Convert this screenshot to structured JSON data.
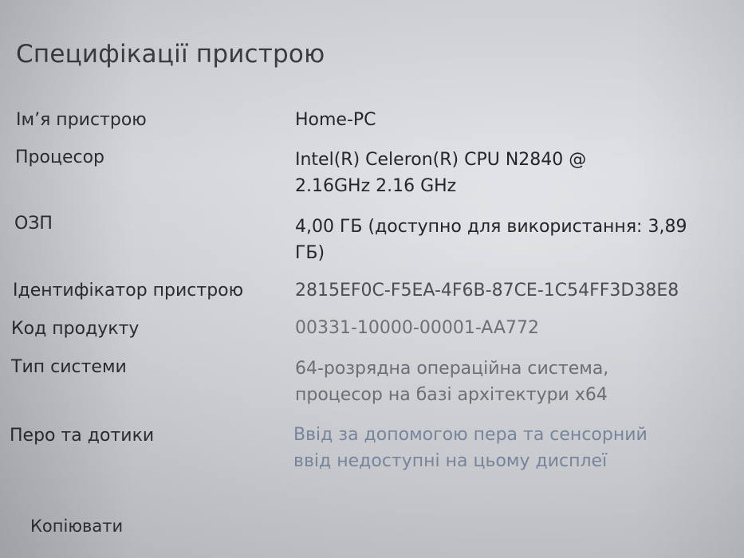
{
  "page": {
    "title": "Специфікації пристрою"
  },
  "specs": [
    {
      "label": "Ім’я пристрою",
      "value_lines": [
        "Home-PC"
      ]
    },
    {
      "label": "Процесор",
      "value_lines": [
        "Intel(R) Celeron(R) CPU  N2840  @",
        "2.16GHz   2.16 GHz"
      ]
    },
    {
      "label": "ОЗП",
      "value_lines": [
        "4,00 ГБ (доступно для використання: 3,89",
        "ГБ)"
      ]
    },
    {
      "label": "Ідентифікатор пристрою",
      "value_lines": [
        "2815EF0C-F5EA-4F6B-87CE-1C54FF3D38E8"
      ]
    },
    {
      "label": "Код продукту",
      "value_lines": [
        "00331-10000-00001-AA772"
      ]
    },
    {
      "label": "Тип системи",
      "value_lines": [
        "64-розрядна операційна система,",
        "процесор на базі архітектури x64"
      ]
    },
    {
      "label": "Перо та дотики",
      "value_lines": [
        "Ввід за допомогою пера та сенсорний",
        "ввід недоступні на цьому дисплеї"
      ]
    }
  ],
  "actions": {
    "copy_label": "Копіювати"
  }
}
